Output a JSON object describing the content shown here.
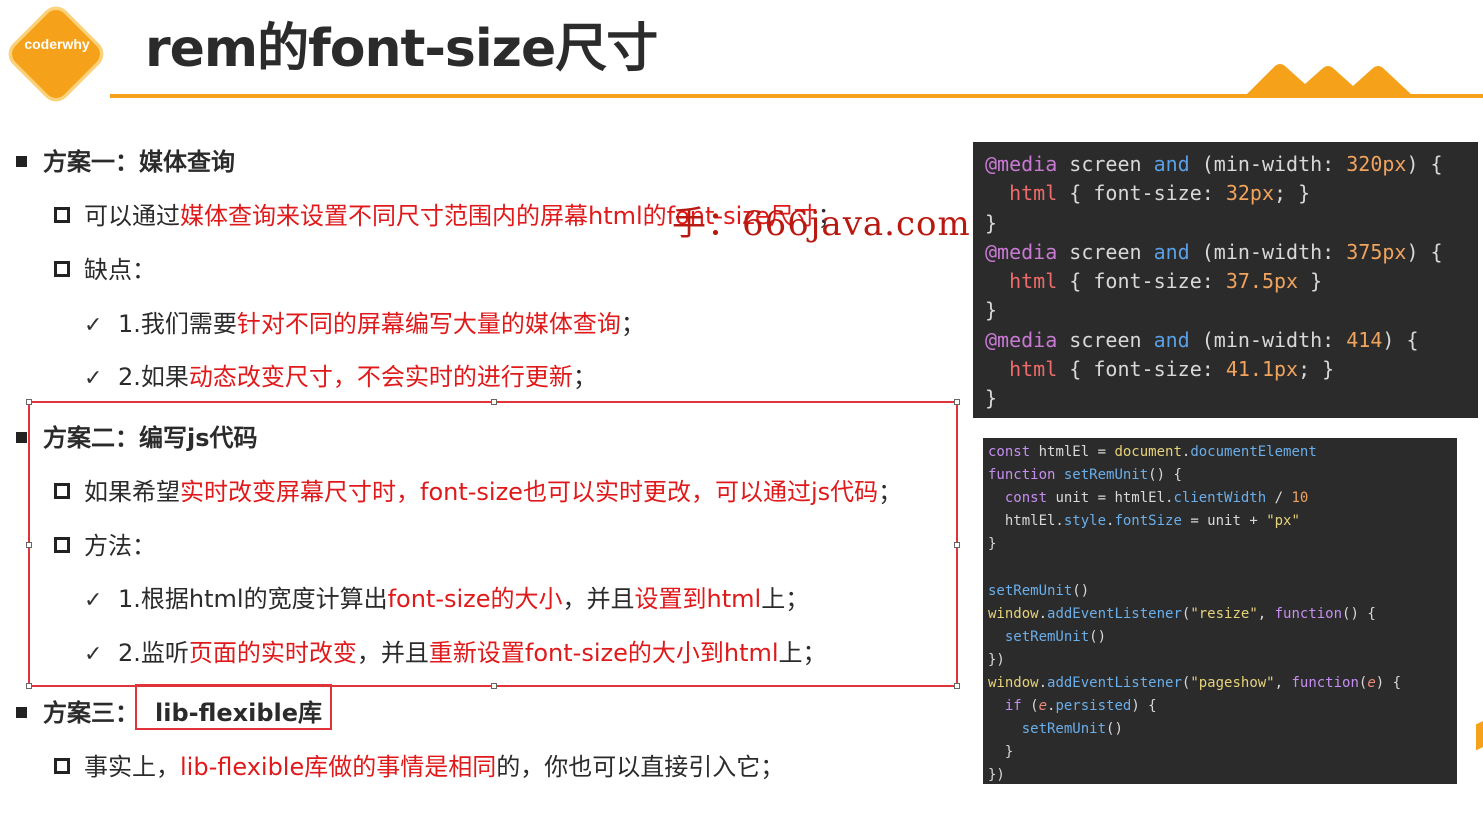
{
  "header": {
    "logo_text": "coderwhy",
    "title": "rem的font-size尺寸"
  },
  "watermark": "手：666java.com",
  "sections": {
    "s1_label": "方案一：媒体查询",
    "s1_item1_pre": "可以通过",
    "s1_item1_red": "媒体查询来设置不同尺寸范围内的屏幕html的font-size尺寸",
    "s1_item1_post": "；",
    "s1_item2": "缺点：",
    "s1_c1_pre": "1.我们需要",
    "s1_c1_red": "针对不同的屏幕编写大量的媒体查询",
    "s1_c1_post": "；",
    "s1_c2_pre": "2.如果",
    "s1_c2_red": "动态改变尺寸，不会实时的进行更新",
    "s1_c2_post": "；",
    "s2_label": "方案二：编写js代码",
    "s2_item1_pre": "如果希望",
    "s2_item1_red": "实时改变屏幕尺寸时，font-size也可以实时更改，可以通过js代码",
    "s2_item1_post": "；",
    "s2_item2": "方法：",
    "s2_c1_pre": "1.根据html的宽度计算出",
    "s2_c1_red": "font-size的大小",
    "s2_c1_mid": "，并且",
    "s2_c1_red2": "设置到html",
    "s2_c1_post": "上；",
    "s2_c2_pre": "2.监听",
    "s2_c2_red": "页面的实时改变",
    "s2_c2_mid": "，并且",
    "s2_c2_red2": "重新设置font-size的大小到html",
    "s2_c2_post": "上；",
    "s3_label": "方案三：",
    "s3_lib": "lib-flexible库",
    "s3_item1_pre": "事实上，",
    "s3_item1_red": "lib-flexible库做的事情是相同",
    "s3_item1_post": "的，你也可以直接引入它；"
  },
  "code_media": [
    "@media screen and (min-width: 320px) {",
    "  html { font-size: 32px; }",
    "}",
    "@media screen and (min-width: 375px) {",
    "  html { font-size: 37.5px }",
    "}",
    "@media screen and (min-width: 414) {",
    "  html { font-size: 41.1px; }",
    "}"
  ],
  "code_js": [
    "const htmlEl = document.documentElement",
    "function setRemUnit() {",
    "  const unit = htmlEl.clientWidth / 10",
    "  htmlEl.style.fontSize = unit + \"px\"",
    "}",
    "",
    "setRemUnit()",
    "window.addEventListener(\"resize\", function() {",
    "  setRemUnit()",
    "})",
    "window.addEventListener(\"pageshow\", function(e) {",
    "  if (e.persisted) {",
    "    setRemUnit()",
    "  }",
    "})"
  ]
}
